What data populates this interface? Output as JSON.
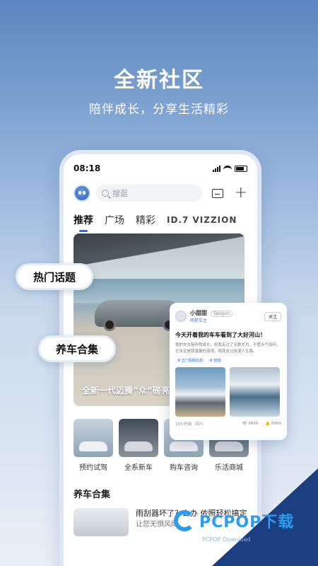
{
  "hero": {
    "title": "全新社区",
    "subtitle": "陪伴成长，分享生活精彩"
  },
  "status_bar": {
    "time": "08:18"
  },
  "topbar": {
    "search_placeholder": "搜逛"
  },
  "tabs": [
    {
      "label": "推荐",
      "active": true
    },
    {
      "label": "广场",
      "active": false
    },
    {
      "label": "精彩",
      "active": false
    },
    {
      "label": "ID.7 VIZZION",
      "active": false
    }
  ],
  "banner": {
    "caption": "全新一代迈腾”众“磅亮相"
  },
  "quick_links": [
    {
      "label": "预约试驾"
    },
    {
      "label": "全系新车"
    },
    {
      "label": "购车咨询"
    },
    {
      "label": "乐活商城"
    }
  ],
  "section": {
    "title": "养车合集",
    "article_title": "雨刮器坏了？么办 依照轻松搞定",
    "article_sub": "让您无惧风雨"
  },
  "pills": {
    "hot_topics": "热门话题",
    "car_care": "养车合集"
  },
  "post_card": {
    "author": "小甜甜",
    "tag": "Tategon",
    "role": "明星车主",
    "follow": "关注",
    "title": "今天开着我的车车看到了大好河山！",
    "body": "我的车车陪伴我成长，和我走过了无数岁月。不管天气如何，它永远是我温馨的港湾，陪我走过迷漫人生路。",
    "chips": [
      "# 五一假期出游",
      "# 旅游"
    ],
    "time": "19小时前 · 四川",
    "views": "9999",
    "likes": "8999"
  },
  "watermark": {
    "brand": "PCPOP下载",
    "sub": "PCPOP Download"
  }
}
